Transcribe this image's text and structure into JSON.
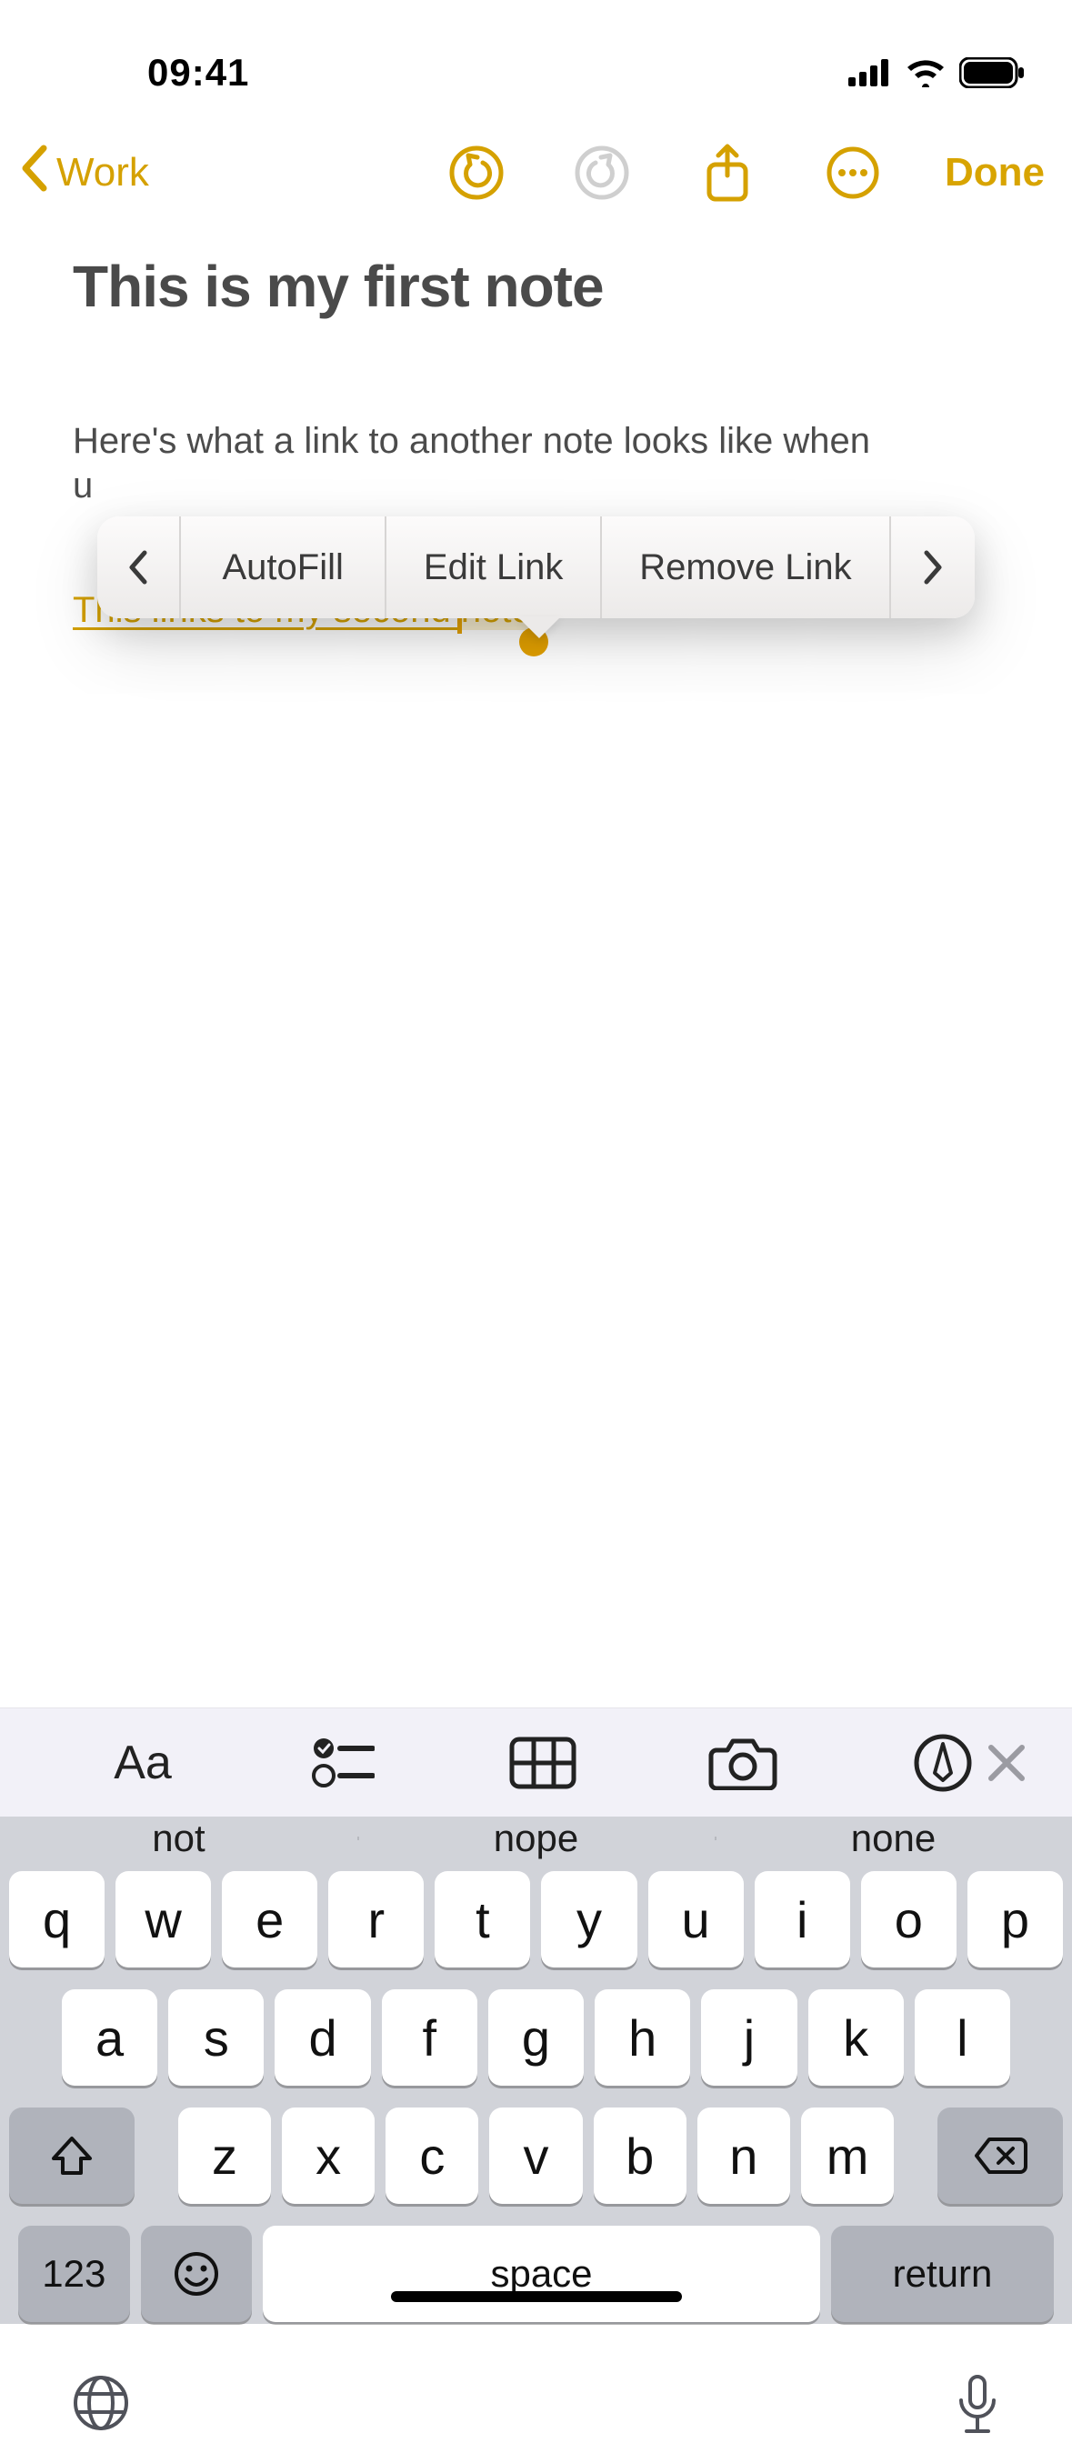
{
  "status": {
    "time": "09:41"
  },
  "nav": {
    "back_label": "Work",
    "done_label": "Done"
  },
  "note": {
    "title": "This is my first note",
    "body_line1": "Here's what a link to another note looks like when",
    "body_line2_visible": "u",
    "link_text_pre": "This links to my second ",
    "link_text_selected": "note"
  },
  "context_menu": {
    "items": [
      "AutoFill",
      "Edit Link",
      "Remove Link"
    ]
  },
  "format_bar": {
    "text_style": "Aa"
  },
  "suggestions": [
    "not",
    "nope",
    "none"
  ],
  "keyboard": {
    "row1": [
      "q",
      "w",
      "e",
      "r",
      "t",
      "y",
      "u",
      "i",
      "o",
      "p"
    ],
    "row2": [
      "a",
      "s",
      "d",
      "f",
      "g",
      "h",
      "j",
      "k",
      "l"
    ],
    "row3": [
      "z",
      "x",
      "c",
      "v",
      "b",
      "n",
      "m"
    ],
    "num_label": "123",
    "space_label": "space",
    "return_label": "return"
  }
}
